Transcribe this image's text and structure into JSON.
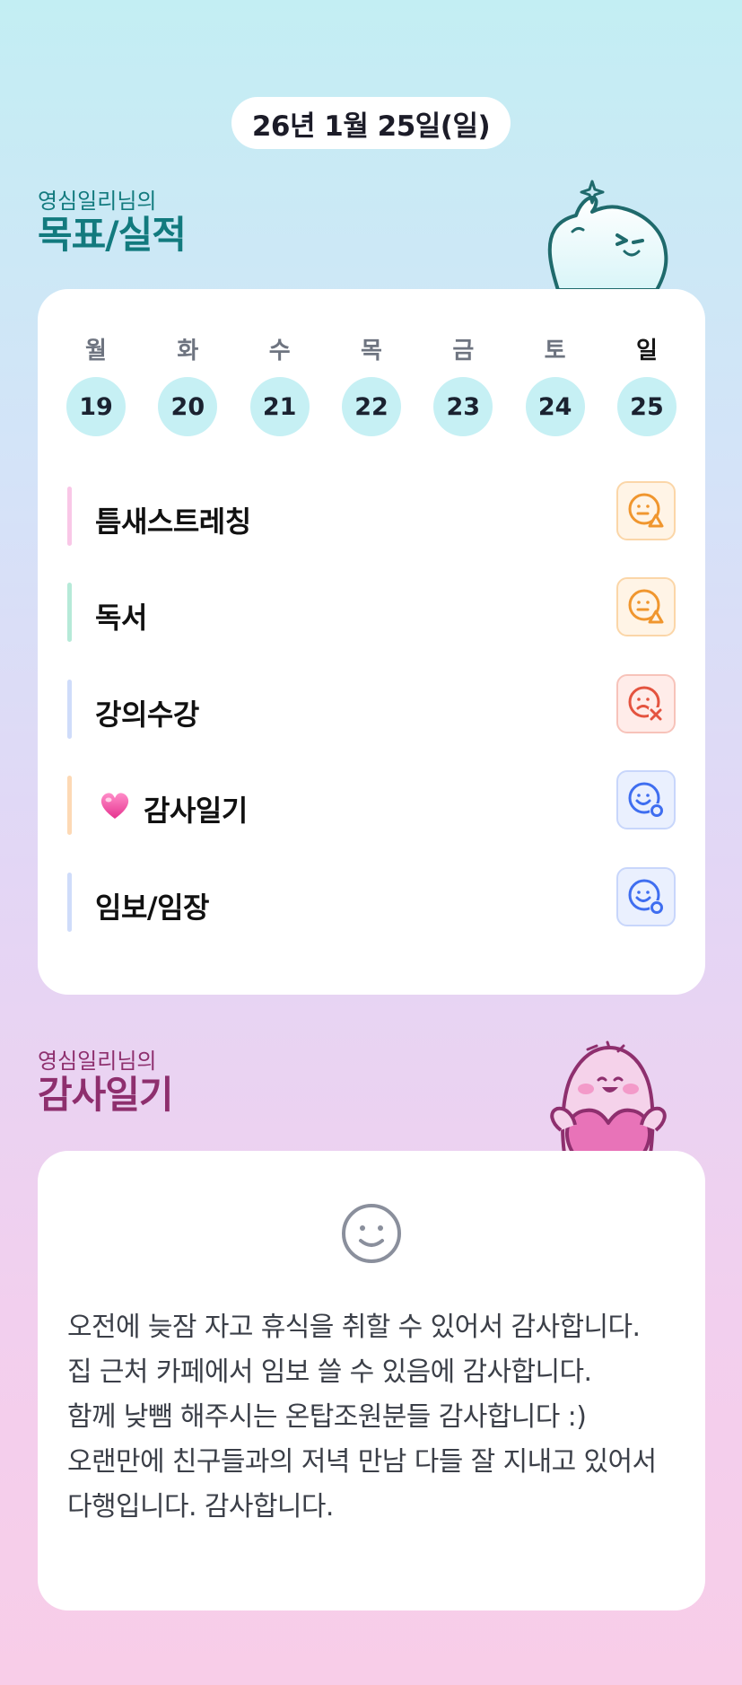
{
  "header": {
    "date": "26년 1월 25일(일)"
  },
  "goals_section": {
    "owner": "영심일리님의",
    "title": "목표/실적",
    "days": [
      {
        "name": "월",
        "date": "19",
        "today": false
      },
      {
        "name": "화",
        "date": "20",
        "today": false
      },
      {
        "name": "수",
        "date": "21",
        "today": false
      },
      {
        "name": "목",
        "date": "22",
        "today": false
      },
      {
        "name": "금",
        "date": "23",
        "today": false
      },
      {
        "name": "토",
        "date": "24",
        "today": false
      },
      {
        "name": "일",
        "date": "25",
        "today": true
      }
    ],
    "goals": [
      {
        "label": "틈새스트레칭",
        "bar_color": "#f9c7e7",
        "status": "partial",
        "status_icon": "smile-triangle-icon",
        "emoji": ""
      },
      {
        "label": "독서",
        "bar_color": "#b6ead8",
        "status": "partial",
        "status_icon": "smile-triangle-icon",
        "emoji": ""
      },
      {
        "label": "강의수강",
        "bar_color": "#cfdcfa",
        "status": "fail",
        "status_icon": "frown-x-icon",
        "emoji": ""
      },
      {
        "label": "감사일기",
        "bar_color": "#fdd9b5",
        "status": "done",
        "status_icon": "smile-circle-icon",
        "emoji": "heart-icon"
      },
      {
        "label": "임보/임장",
        "bar_color": "#cfdcfa",
        "status": "done",
        "status_icon": "smile-circle-icon",
        "emoji": ""
      }
    ],
    "colors": {
      "partial": "#f0962e",
      "fail": "#e4533f",
      "done": "#3f6ef0",
      "day_circle": "#c6f0f4",
      "title": "#127a7e"
    }
  },
  "gratitude_section": {
    "owner": "영심일리님의",
    "title": "감사일기",
    "mood_icon": "smile-face-icon",
    "entry": "오전에 늦잠 자고 휴식을 취할 수 있어서 감사합니다.\n집 근처 카페에서 임보 쓸 수 있음에 감사합니다.\n함께 낮뺌 해주시는 온탑조원분들 감사합니다 :)\n오랜만에 친구들과의 저녁 만남 다들 잘 지내고 있어서 다행입니다. 감사합니다.",
    "colors": {
      "title": "#8e2f6e",
      "heart": "#e873b8"
    }
  }
}
